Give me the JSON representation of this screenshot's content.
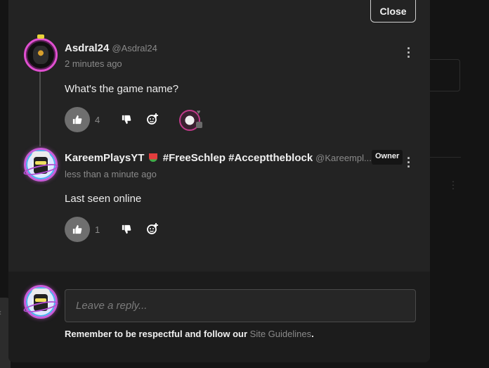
{
  "modal": {
    "close_label": "Close"
  },
  "comments": [
    {
      "author": "Asdral24",
      "handle": "@Asdral24",
      "time": "2 minutes ago",
      "text": "What's the game name?",
      "likes": "4"
    },
    {
      "author_prefix": "KareemPlaysYT",
      "author_suffix": "#FreeSchlep #Accepttheblock",
      "handle": "@Kareempl...",
      "badge": "Owner",
      "time": "less than a minute ago",
      "text": "Last seen online",
      "likes": "1"
    }
  ],
  "reply": {
    "placeholder": "Leave a reply...",
    "note_prefix": "Remember to be respectful and follow our",
    "note_link": "Site Guidelines",
    "note_suffix": "."
  },
  "colors": {
    "modal_bg": "#232323",
    "reply_bg": "#1c1c1c",
    "like_button": "#6f6f6f",
    "avatar_ring": "#e04fd0"
  },
  "icons": [
    "thumbs-up-icon",
    "thumbs-down-icon",
    "add-reaction-icon",
    "kebab-menu-icon",
    "watermelon-emoji"
  ]
}
